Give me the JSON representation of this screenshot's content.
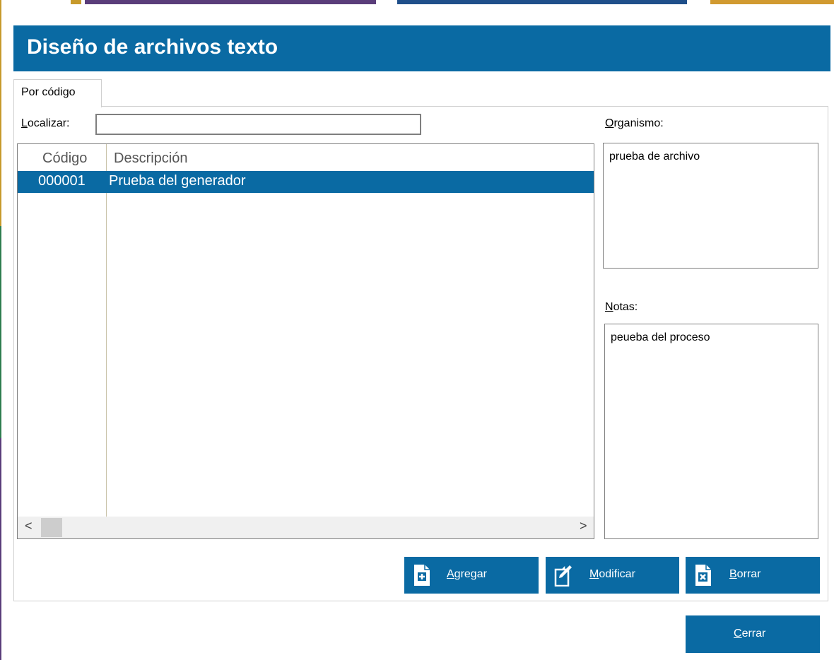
{
  "window": {
    "title": "Diseño de archivos texto"
  },
  "tabs": [
    {
      "label": "Por código"
    }
  ],
  "search": {
    "label_key": "L",
    "label_rest": "ocalizar:",
    "value": ""
  },
  "table": {
    "columns": [
      "Código",
      "Descripción"
    ],
    "rows": [
      {
        "codigo": "000001",
        "descripcion": "Prueba del generador",
        "selected": true
      }
    ],
    "scroll_left": "<",
    "scroll_right": ">"
  },
  "organismo": {
    "label_key": "O",
    "label_rest": "rganismo:",
    "value": "prueba de archivo"
  },
  "notas": {
    "label_key": "N",
    "label_rest": "otas:",
    "value": "peueba del proceso"
  },
  "buttons": {
    "agregar": {
      "key": "A",
      "rest": "gregar",
      "icon": "add-document-icon"
    },
    "modificar": {
      "key": "M",
      "rest": "odificar",
      "icon": "edit-document-icon"
    },
    "borrar": {
      "key": "B",
      "rest": "orrar",
      "icon": "delete-document-icon"
    },
    "cerrar": {
      "key": "C",
      "rest": "errar"
    }
  },
  "colors": {
    "accent": "#0a6aa3",
    "grid_border": "#7f7f7f"
  }
}
